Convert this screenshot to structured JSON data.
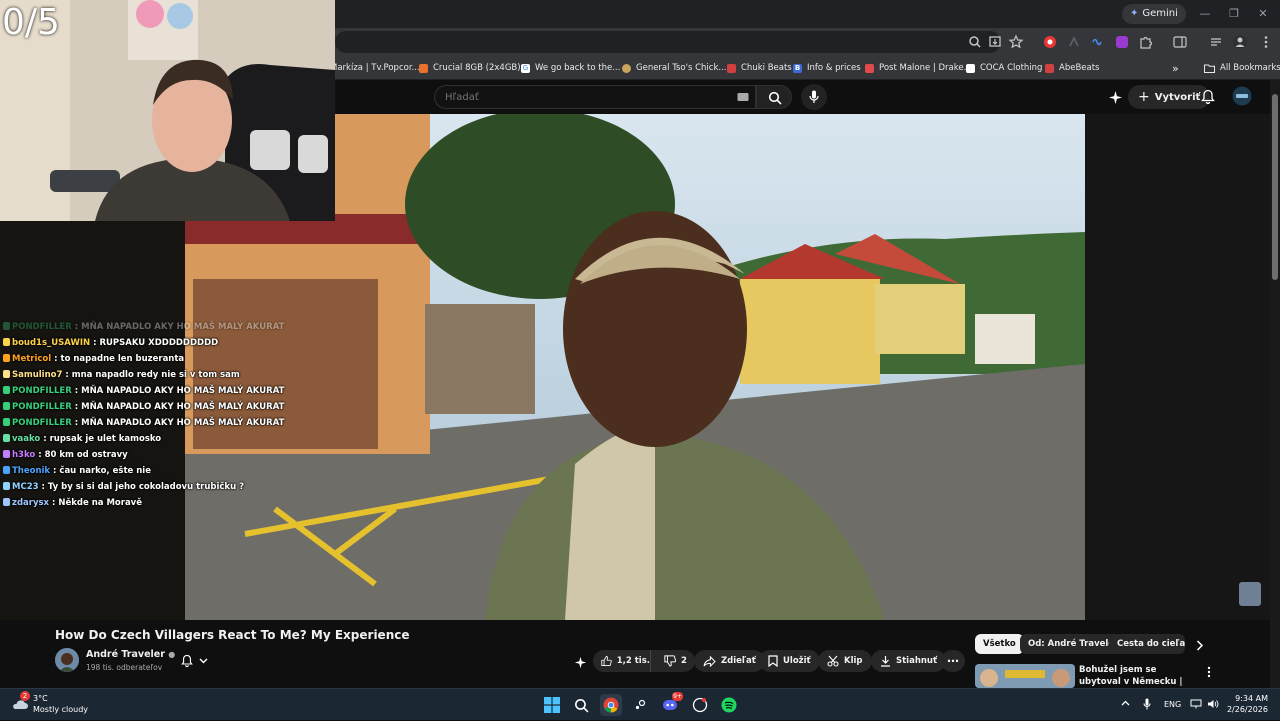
{
  "browser": {
    "gemini_label": "Gemini",
    "bookmarks": [
      {
        "label": "Markíza | Tv.Popcor...",
        "color": "#9aa0a6"
      },
      {
        "label": "Crucial 8GB (2x4GB)...",
        "color": "#e8712b"
      },
      {
        "label": "We go back to the...",
        "color": "#4285f4"
      },
      {
        "label": "General Tso's Chick...",
        "color": "#c9a45b"
      },
      {
        "label": "Chuki Beats",
        "color": "#d23f3f"
      },
      {
        "label": "Info & prices",
        "color": "#3b6bd6"
      },
      {
        "label": "Post Malone | Drake...",
        "color": "#e04a4a"
      },
      {
        "label": "COCA Clothing",
        "color": "#ffffff"
      },
      {
        "label": "AbeBeats",
        "color": "#d23f3f"
      }
    ],
    "more_bookmarks": "»",
    "all_bookmarks": "All Bookmarks"
  },
  "youtube": {
    "search_placeholder": "Hľadať",
    "create_label": "Vytvoriť",
    "video_title": "How Do Czech Villagers React To Me? My Experience",
    "channel_name": "André Traveler",
    "channel_subs": "198 tis. odberateľov",
    "actions": {
      "like_count": "1,2 tis.",
      "dislike_count": "2",
      "share": "Zdieľať",
      "save": "Uložiť",
      "clip": "Klip",
      "download": "Stiahnuť",
      "more": "⋯"
    },
    "chips": [
      "Všetko",
      "Od: André Traveler",
      "Cesta do cieľa Eu"
    ],
    "rec_title": "Bohužel jsem se ubytoval v Německu | Brána do Alp -"
  },
  "overlay": {
    "counter": "0/5",
    "chat": [
      {
        "user": "PONDFILLER",
        "color": "#36d07c",
        "msg": "MŇA NAPADLO AKY HO MAŠ MALÝ AKURAT",
        "faded": true
      },
      {
        "user": "boud1s_USAWIN",
        "color": "#ffd24a",
        "msg": "RUPSAKU XDDDDDDDDD",
        "faded": false
      },
      {
        "user": "Metricol",
        "color": "#ffa21d",
        "msg": "to napadne len buzeranta",
        "faded": false
      },
      {
        "user": "Samulino7",
        "color": "#ffe08a",
        "msg": "mna napadlo redy nie si v tom sam",
        "faded": false
      },
      {
        "user": "PONDFILLER",
        "color": "#36d07c",
        "msg": "MŇA NAPADLO AKY HO MAŠ MALÝ AKURAT",
        "faded": false
      },
      {
        "user": "PONDFILLER",
        "color": "#36d07c",
        "msg": "MŇA NAPADLO AKY HO MAŠ MALÝ AKURAT",
        "faded": false
      },
      {
        "user": "PONDFILLER",
        "color": "#36d07c",
        "msg": "MŇA NAPADLO AKY HO MAŠ MALÝ AKURAT",
        "faded": false
      },
      {
        "user": "vaako",
        "color": "#67e0a3",
        "msg": "rupsak je ulet kamosko",
        "faded": false
      },
      {
        "user": "h3ko",
        "color": "#c77dff",
        "msg": "80 km od ostravy",
        "faded": false
      },
      {
        "user": "Theonik",
        "color": "#4aa3ff",
        "msg": "čau narko, ešte nie",
        "faded": false
      },
      {
        "user": "MC23",
        "color": "#8fd3ff",
        "msg": "Ty by si si dal jeho cokoladovu trubičku ?",
        "faded": false
      },
      {
        "user": "zdarysx",
        "color": "#9ec6ff",
        "msg": "Někde na Moravě",
        "faded": false
      }
    ]
  },
  "taskbar": {
    "weather_temp": "3°C",
    "weather_desc": "Mostly cloudy",
    "weather_badge": "2",
    "discord_badge": "9+",
    "lang": "ENG",
    "time": "9:34 AM",
    "date": "2/26/2026"
  }
}
